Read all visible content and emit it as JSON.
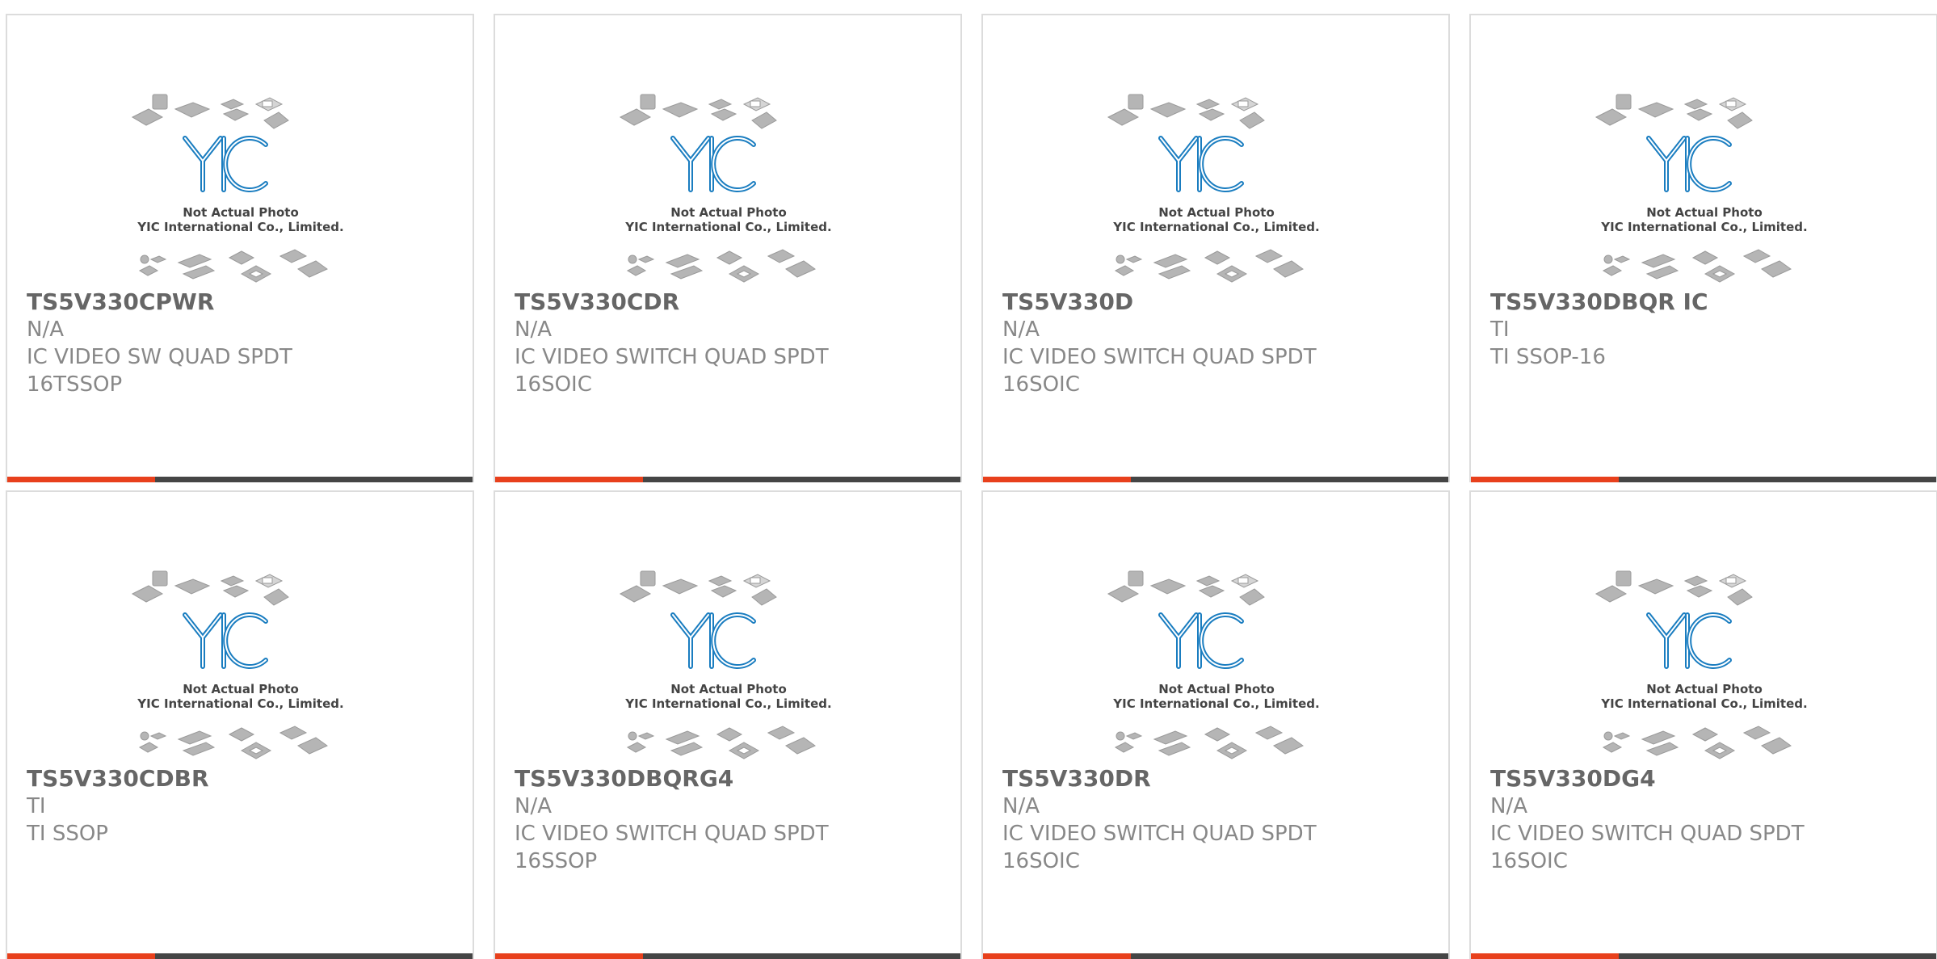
{
  "colors": {
    "accent": "#e8401c",
    "bar": "#454545",
    "logo": "#1a7dc0"
  },
  "placeholder": {
    "logo_text": "YIC",
    "caption_line1": "Not Actual Photo",
    "caption_line2": "YIC International Co., Limited."
  },
  "products": [
    {
      "part": "TS5V330CPWR",
      "lines": [
        "N/A",
        "IC VIDEO SW QUAD SPDT",
        "16TSSOP"
      ]
    },
    {
      "part": "TS5V330CDR",
      "lines": [
        "N/A",
        "IC VIDEO SWITCH QUAD SPDT",
        "16SOIC"
      ]
    },
    {
      "part": "TS5V330D",
      "lines": [
        "N/A",
        "IC VIDEO SWITCH QUAD SPDT",
        "16SOIC"
      ]
    },
    {
      "part": "TS5V330DBQR IC",
      "lines": [
        "TI",
        "TI SSOP-16"
      ]
    },
    {
      "part": "TS5V330CDBR",
      "lines": [
        "TI",
        "TI SSOP"
      ]
    },
    {
      "part": "TS5V330DBQRG4",
      "lines": [
        "N/A",
        "IC VIDEO SWITCH QUAD SPDT",
        "16SSOP"
      ]
    },
    {
      "part": "TS5V330DR",
      "lines": [
        "N/A",
        "IC VIDEO SWITCH QUAD SPDT",
        "16SOIC"
      ]
    },
    {
      "part": "TS5V330DG4",
      "lines": [
        "N/A",
        "IC VIDEO SWITCH QUAD SPDT",
        "16SOIC"
      ]
    }
  ]
}
